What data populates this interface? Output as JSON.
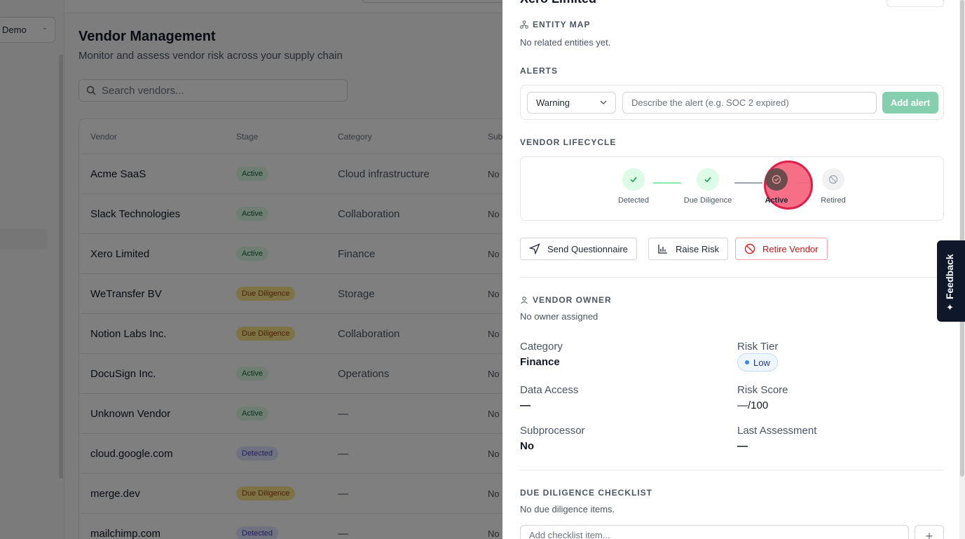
{
  "app": {
    "workspace_label": "Demo",
    "page_title": "Vendor Management",
    "page_subtitle": "Monitor and assess vendor risk across your supply chain",
    "search_placeholder": "Search vendors..."
  },
  "table": {
    "headers": [
      "Vendor",
      "Stage",
      "Category",
      "Sub"
    ],
    "rows": [
      {
        "vendor": "Acme SaaS",
        "stage": "Active",
        "category": "Cloud infrastructure",
        "sub": "No"
      },
      {
        "vendor": "Slack Technologies",
        "stage": "Active",
        "category": "Collaboration",
        "sub": "No"
      },
      {
        "vendor": "Xero Limited",
        "stage": "Active",
        "category": "Finance",
        "sub": "No"
      },
      {
        "vendor": "WeTransfer BV",
        "stage": "Due Diligence",
        "category": "Storage",
        "sub": "No"
      },
      {
        "vendor": "Notion Labs Inc.",
        "stage": "Due Diligence",
        "category": "Collaboration",
        "sub": "No"
      },
      {
        "vendor": "DocuSign Inc.",
        "stage": "Active",
        "category": "Operations",
        "sub": "No"
      },
      {
        "vendor": "Unknown Vendor",
        "stage": "Active",
        "category": "—",
        "sub": "No"
      },
      {
        "vendor": "cloud.google.com",
        "stage": "Detected",
        "category": "—",
        "sub": "No"
      },
      {
        "vendor": "merge.dev",
        "stage": "Due Diligence",
        "category": "—",
        "sub": "No"
      },
      {
        "vendor": "mailchimp.com",
        "stage": "Detected",
        "category": "—",
        "sub": "No"
      }
    ]
  },
  "panel": {
    "title": "Xero Limited",
    "entity_map": {
      "label": "ENTITY MAP",
      "empty": "No related entities yet."
    },
    "alerts": {
      "label": "ALERTS",
      "severity_value": "Warning",
      "input_placeholder": "Describe the alert (e.g. SOC 2 expired)",
      "add_label": "Add alert"
    },
    "lifecycle": {
      "label": "VENDOR LIFECYCLE",
      "steps": [
        "Detected",
        "Due Diligence",
        "Active",
        "Retired"
      ],
      "current": "Active"
    },
    "actions": {
      "questionnaire": "Send Questionnaire",
      "raise_risk": "Raise Risk",
      "retire": "Retire Vendor"
    },
    "owner": {
      "label": "VENDOR OWNER",
      "empty": "No owner assigned"
    },
    "fields": {
      "category_label": "Category",
      "category_value": "Finance",
      "risk_tier_label": "Risk Tier",
      "risk_tier_value": "Low",
      "data_access_label": "Data Access",
      "data_access_value": "—",
      "risk_score_label": "Risk Score",
      "risk_score_value": "—/100",
      "subprocessor_label": "Subprocessor",
      "subprocessor_value": "No",
      "last_assessment_label": "Last Assessment",
      "last_assessment_value": "—"
    },
    "checklist": {
      "label": "DUE DILIGENCE CHECKLIST",
      "empty": "No due diligence items.",
      "input_placeholder": "Add checklist item..."
    }
  },
  "feedback_label": "Feedback",
  "colors": {
    "accent_green": "#86cfae",
    "danger": "#b91c1c",
    "highlight": "#e11d48"
  }
}
